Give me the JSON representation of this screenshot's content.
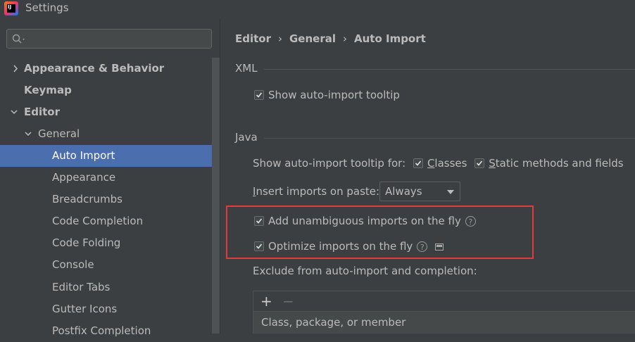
{
  "window": {
    "title": "Settings",
    "app_icon": "intellij-idea-icon",
    "app_icon_text": "IJ"
  },
  "search": {
    "placeholder": "",
    "value": ""
  },
  "tree": [
    {
      "label": "Appearance & Behavior",
      "bold": true,
      "arrow": "collapsed"
    },
    {
      "label": "Keymap",
      "bold": true,
      "arrow": "none"
    },
    {
      "label": "Editor",
      "bold": true,
      "arrow": "expanded"
    },
    {
      "label": "General",
      "bold": false,
      "arrow": "expanded"
    },
    {
      "label": "Auto Import",
      "bold": false,
      "selected": true
    },
    {
      "label": "Appearance"
    },
    {
      "label": "Breadcrumbs"
    },
    {
      "label": "Code Completion"
    },
    {
      "label": "Code Folding"
    },
    {
      "label": "Console"
    },
    {
      "label": "Editor Tabs"
    },
    {
      "label": "Gutter Icons"
    },
    {
      "label": "Postfix Completion"
    }
  ],
  "breadcrumb": {
    "items": [
      "Editor",
      "General",
      "Auto Import"
    ],
    "separator": "›"
  },
  "xml": {
    "title": "XML",
    "show_tooltip_label": "Show auto-import tooltip",
    "show_tooltip_checked": true
  },
  "java": {
    "title": "Java",
    "tooltip_for_label": "Show auto-import tooltip for:",
    "classes_label": "Classes",
    "classes_checked": true,
    "static_label": "Static methods and fields",
    "static_checked": true,
    "insert_label": "Insert imports on paste:",
    "insert_value": "Always",
    "add_unambiguous_label": "Add unambiguous imports on the fly",
    "add_unambiguous_checked": true,
    "optimize_label": "Optimize imports on the fly",
    "optimize_checked": true,
    "exclude_label": "Exclude from auto-import and completion:",
    "table_add": "+",
    "table_remove": "−",
    "table_placeholder": "Class, package, or member"
  },
  "colors": {
    "selection": "#4b6eaf",
    "highlight_border": "#e03c3c",
    "background": "#3c3f41"
  }
}
